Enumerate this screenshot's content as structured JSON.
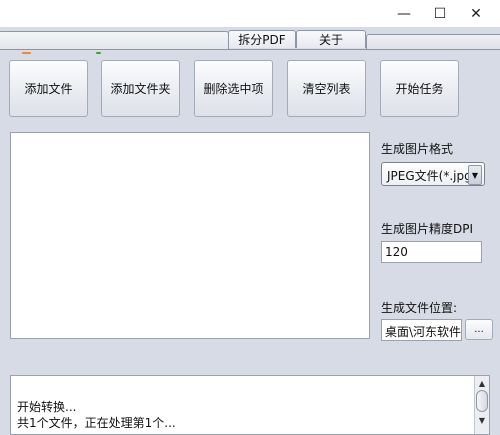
{
  "window": {
    "minimize_glyph": "—",
    "maximize_glyph": "☐",
    "close_glyph": "✕"
  },
  "tabs": [
    {
      "label": "拆分PDF"
    },
    {
      "label": "关于"
    }
  ],
  "toolbar": {
    "add_file": "添加文件",
    "add_folder": "添加文件夹",
    "delete_selected": "删除选中项",
    "clear_list": "清空列表",
    "start_task": "开始任务"
  },
  "settings": {
    "format_label": "生成图片格式",
    "format_value": "JPEG文件(*.jpg)",
    "dpi_label": "生成图片精度DPI",
    "dpi_value": "120",
    "output_label": "生成文件位置:",
    "output_value": "桌面\\河东软件园",
    "browse_label": "..."
  },
  "log": {
    "lines": [
      "开始转换...",
      "共1个文件，正在处理第1个..."
    ]
  },
  "colors": {
    "background": "#d6dbe6",
    "accent_orange": "#f08a24",
    "accent_green": "#3aa03a"
  }
}
